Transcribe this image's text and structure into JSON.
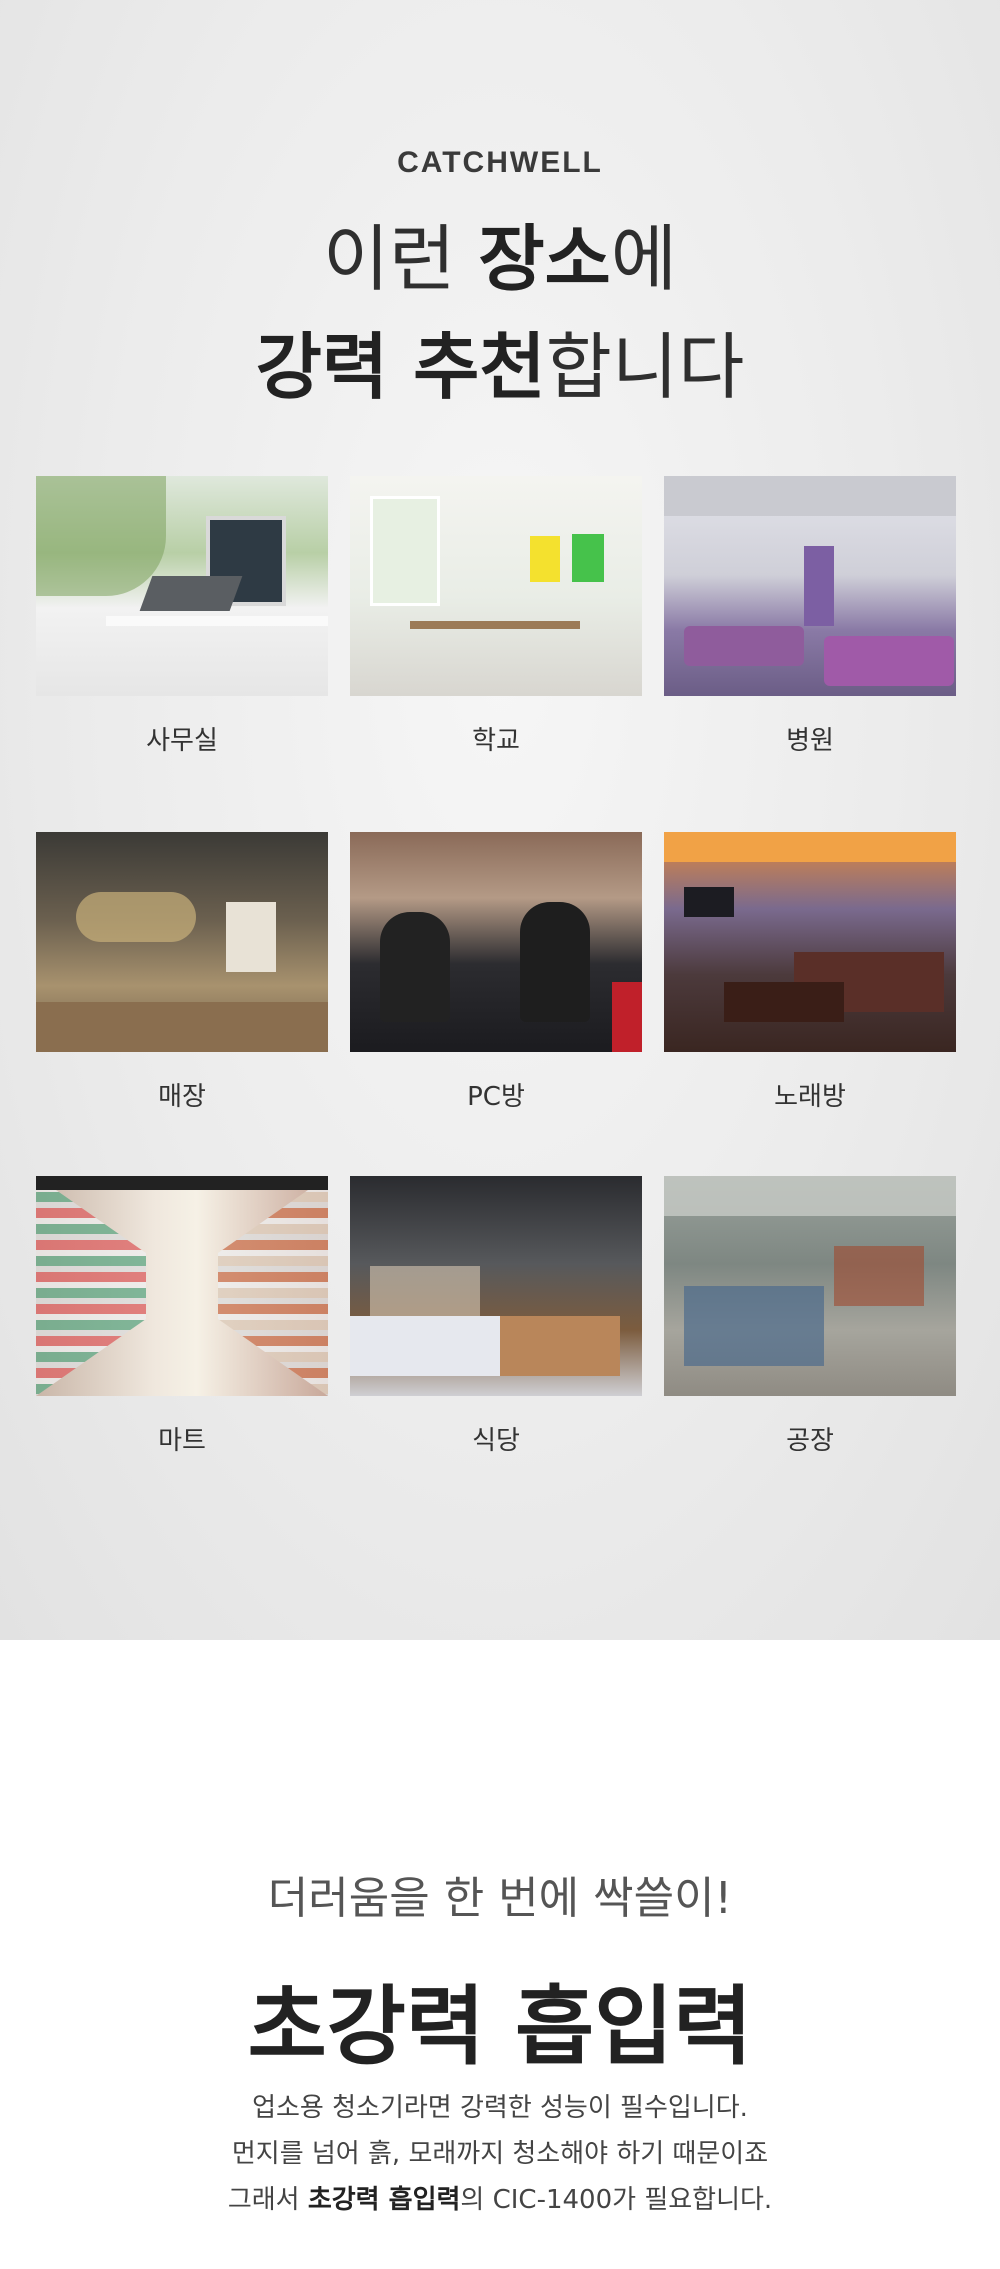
{
  "brand": "CATCHWELL",
  "headline": {
    "line1_plain1": "이런 ",
    "line1_em": "장소",
    "line1_plain2": "에",
    "line2_em": "강력 추천",
    "line2_plain": "합니다"
  },
  "places": [
    {
      "label": "사무실",
      "icon": "office-photo"
    },
    {
      "label": "학교",
      "icon": "school-photo"
    },
    {
      "label": "병원",
      "icon": "hospital-photo"
    },
    {
      "label": "매장",
      "icon": "store-photo"
    },
    {
      "label": "PC방",
      "icon": "pc-cafe-photo"
    },
    {
      "label": "노래방",
      "icon": "karaoke-photo"
    },
    {
      "label": "마트",
      "icon": "mart-photo"
    },
    {
      "label": "식당",
      "icon": "restaurant-photo"
    },
    {
      "label": "공장",
      "icon": "factory-photo"
    }
  ],
  "suction": {
    "subheading": "더러움을 한 번에 싹쓸이!",
    "heading": "초강력 흡입력",
    "desc_line1": "업소용 청소기라면 강력한 성능이 필수입니다.",
    "desc_line2": "먼지를 넘어 흙, 모래까지 청소해야 하기 때문이죠",
    "desc_line3_pre": "그래서 ",
    "desc_line3_bold": "초강력 흡입력",
    "desc_line3_post": "의 CIC-1400가 필요합니다."
  }
}
